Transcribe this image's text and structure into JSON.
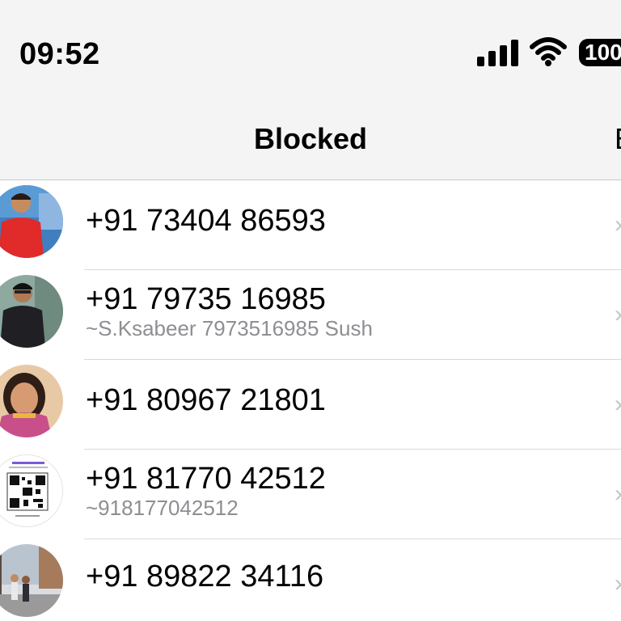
{
  "status_bar": {
    "time": "09:52",
    "battery": "100"
  },
  "nav": {
    "title": "Blocked",
    "right_label": "E"
  },
  "blocked_contacts": [
    {
      "phone": "+91 73404 86593",
      "subtitle": "",
      "avatar": "person-red-shirt-avatar"
    },
    {
      "phone": "+91 79735 16985",
      "subtitle": "~S.Ksabeer 7973516985 Sush",
      "avatar": "person-black-jacket-avatar"
    },
    {
      "phone": "+91 80967 21801",
      "subtitle": "",
      "avatar": "child-portrait-avatar"
    },
    {
      "phone": "+91 81770 42512",
      "subtitle": "~918177042512",
      "avatar": "qr-code-avatar"
    },
    {
      "phone": "+91 89822 34116",
      "subtitle": "",
      "avatar": "street-couple-avatar"
    }
  ],
  "colors": {
    "header_bg": "#f4f4f5",
    "subtitle_gray": "#8e8e93",
    "divider": "#d9d9dc"
  }
}
